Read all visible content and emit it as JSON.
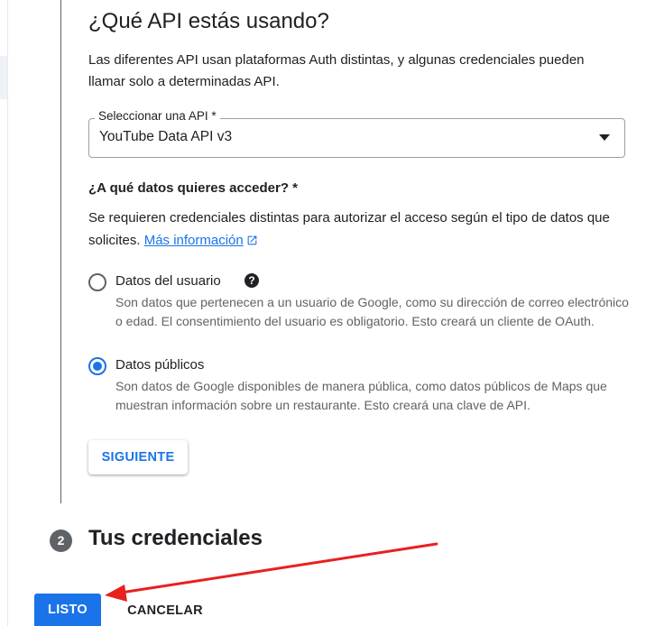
{
  "step1": {
    "title": "¿Qué API estás usando?",
    "intro": "Las diferentes API usan plataformas Auth distintas, y algunas credenciales pueden llamar solo a determinadas API.",
    "api_select": {
      "label": "Seleccionar una API *",
      "value": "YouTube Data API v3"
    },
    "data_question": {
      "title": "¿A qué datos quieres acceder? *",
      "description": "Se requieren credenciales distintas para autorizar el acceso según el tipo de datos que solicites.",
      "link_label": "Más información"
    },
    "options": [
      {
        "label": "Datos del usuario",
        "description": "Son datos que pertenecen a un usuario de Google, como su dirección de correo electrónico o edad. El consentimiento del usuario es obligatorio. Esto creará un cliente de OAuth.",
        "selected": false
      },
      {
        "label": "Datos públicos",
        "description": "Son datos de Google disponibles de manera pública, como datos públicos de Maps que muestran información sobre un restaurante. Esto creará una clave de API.",
        "selected": true
      }
    ],
    "next_button": "SIGUIENTE"
  },
  "step2": {
    "number": "2",
    "title": "Tus credenciales"
  },
  "actions": {
    "done": "LISTO",
    "cancel": "CANCELAR"
  },
  "colors": {
    "accent": "#1a73e8",
    "annotation_arrow": "#e8201f"
  },
  "icons": {
    "help": "help-icon",
    "external_link": "open-in-new-icon",
    "dropdown": "dropdown-arrow-icon"
  }
}
